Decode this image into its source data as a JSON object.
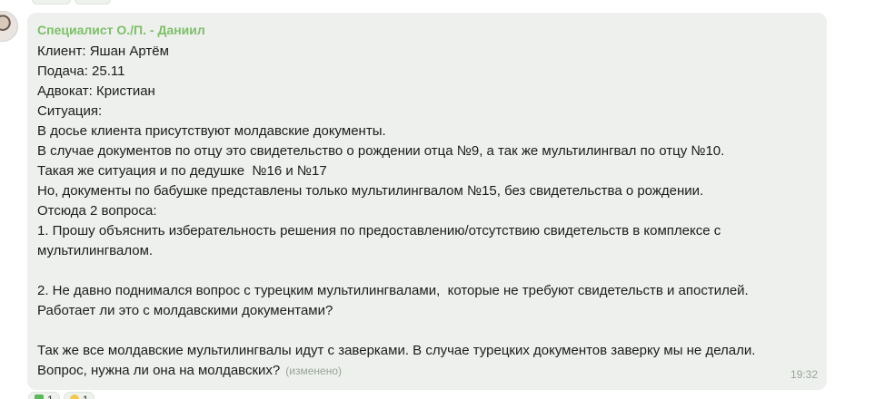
{
  "message": {
    "sender": "Специалист О./П. - Даниил",
    "lines": [
      "Клиент: Яшан Артём",
      "Подача: 25.11",
      "Адвокат: Кристиан",
      "Ситуация:",
      "В досье клиента присутствуют молдавские документы.",
      "В случае документов по отцу это свидетельство о рождении отца №9, а так же мультилингвал по отцу №10.",
      "Такая же ситуация и по дедушке  №16 и №17",
      "Но, документы по бабушке представлены только мультилингвалом №15, без свидетельства о рождении.",
      "Отсюда 2 вопроса:",
      "1. Прошу объяснить изберательность решения по предоставлению/отсутствию свидетельств в комплексе с",
      "мультилингвалом.",
      "",
      "2. Не давно поднимался вопрос с турецким мультилингвалами,  которые не требуют свидетельств и апостилей.",
      "Работает ли это с молдавскими документами?",
      "",
      "Так же все молдавские мультилингвалы идут с заверками. В случае турецких документов заверку мы не делали.",
      "Вопрос, нужна ли она на молдавских?"
    ],
    "edited_label": "(изменено)",
    "time": "19:32"
  },
  "reactions": [
    {
      "icon": "check-mark-icon",
      "color": "#5bb85b",
      "count": "1"
    },
    {
      "icon": "thumbs-up-icon",
      "color": "#f2c94c",
      "count": "1"
    }
  ],
  "colors": {
    "bubble_bg": "#edf0ec",
    "sender": "#7ebf6a",
    "meta": "#9aa39a"
  }
}
